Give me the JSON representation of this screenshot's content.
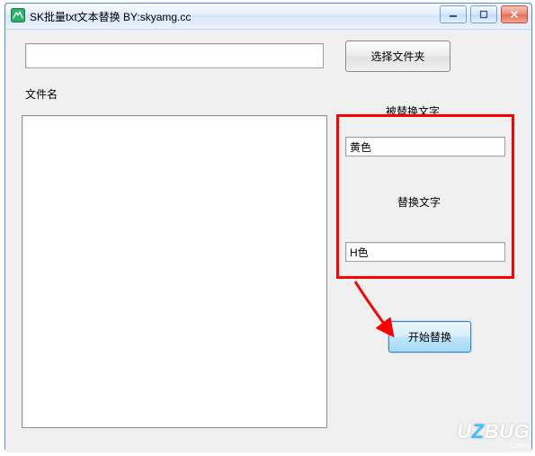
{
  "window": {
    "title": "SK批量txt文本替换 BY:skyamg.cc"
  },
  "controls": {
    "minimize_tip": "最小化",
    "maximize_tip": "最大化",
    "close_tip": "关闭"
  },
  "top": {
    "path_value": "",
    "select_folder_label": "选择文件夹"
  },
  "labels": {
    "filename": "文件名",
    "replaced_text": "被替换文字",
    "replace_with": "替换文字"
  },
  "replace": {
    "from_value": "黄色",
    "to_value": "H色"
  },
  "actions": {
    "start_label": "开始替换"
  },
  "watermark": {
    "line1_pre": "U",
    "line1_mid": "Z",
    "line1_post": "BUG",
    "line2": ".com"
  }
}
